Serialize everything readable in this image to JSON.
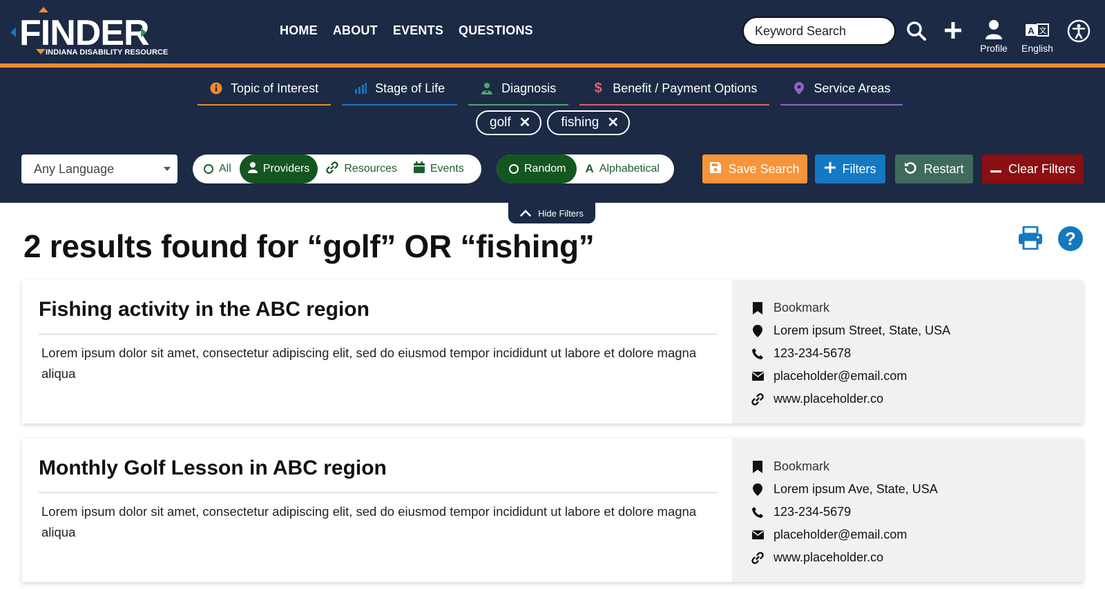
{
  "brand": {
    "name": "FINDER",
    "subtitle": "INDIANA DISABILITY RESOURCE"
  },
  "nav": {
    "items": [
      "HOME",
      "ABOUT",
      "EVENTS",
      "QUESTIONS"
    ]
  },
  "header": {
    "search_placeholder": "Keyword Search",
    "profile_label": "Profile",
    "language_label": "English"
  },
  "categories": [
    {
      "label": "Topic of Interest",
      "icon": "info-icon",
      "color": "#ef8a2f"
    },
    {
      "label": "Stage of Life",
      "icon": "bar-chart-icon",
      "color": "#1578c2"
    },
    {
      "label": "Diagnosis",
      "icon": "doctor-icon",
      "color": "#4fa56f"
    },
    {
      "label": "Benefit / Payment Options",
      "icon": "dollar-icon",
      "color": "#e0626a"
    },
    {
      "label": "Service Areas",
      "icon": "map-pin-icon",
      "color": "#8f64c4"
    }
  ],
  "chips": [
    "golf",
    "fishing"
  ],
  "controls": {
    "language_select": "Any Language",
    "type_options": [
      "All",
      "Providers",
      "Resources",
      "Events"
    ],
    "type_selected": "Providers",
    "sort_options": [
      "Random",
      "Alphabetical"
    ],
    "sort_selected": "Random",
    "save_search": "Save Search",
    "filters": "Filters",
    "restart": "Restart",
    "clear_filters": "Clear Filters",
    "hide_filters": "Hide Filters"
  },
  "colors": {
    "navy": "#1c2a45",
    "orange": "#ef8a2f",
    "green": "#14561f",
    "save": "#f5943a",
    "filters": "#1578c2",
    "restart": "#3f6a5e",
    "clear": "#8a0f12"
  },
  "results": {
    "heading": "2 results found for “golf” OR “fishing”",
    "items": [
      {
        "title": "Fishing activity in the ABC region",
        "description": "Lorem ipsum dolor sit amet, consectetur adipiscing elit, sed do eiusmod tempor incididunt ut labore et dolore magna aliqua",
        "bookmark": "Bookmark",
        "address": "Lorem ipsum Street, State, USA",
        "phone": "123-234-5678",
        "email": "placeholder@email.com",
        "website": "www.placeholder.co"
      },
      {
        "title": "Monthly Golf Lesson in ABC region",
        "description": "Lorem ipsum dolor sit amet, consectetur adipiscing elit, sed do eiusmod tempor incididunt ut labore et dolore magna aliqua",
        "bookmark": "Bookmark",
        "address": "Lorem ipsum Ave, State, USA",
        "phone": "123-234-5679",
        "email": "placeholder@email.com",
        "website": "www.placeholder.co"
      }
    ]
  }
}
